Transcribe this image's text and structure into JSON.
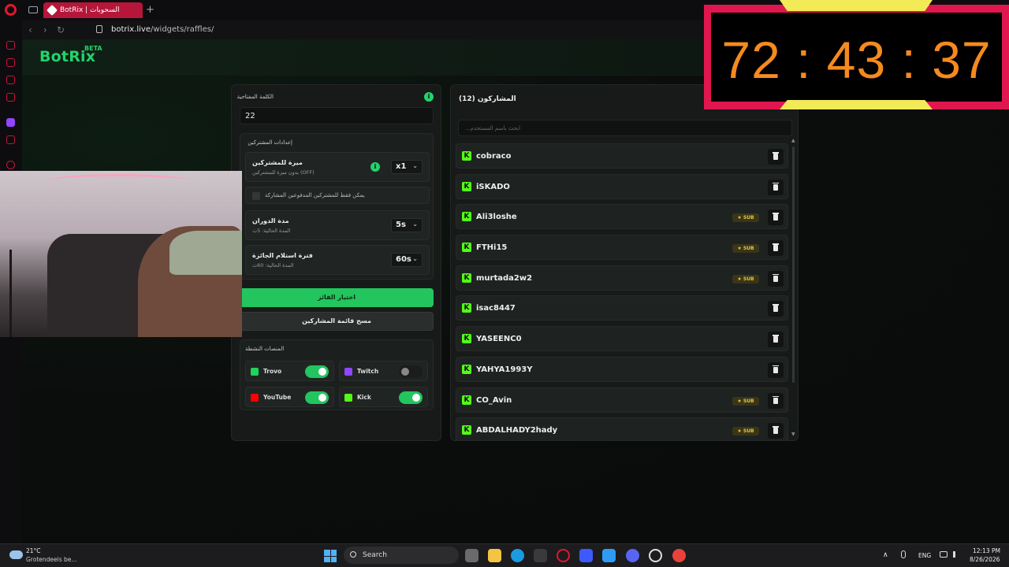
{
  "browser": {
    "tab_title": "BotRix | السحوبات",
    "new_tab": "+",
    "url_host": "botrix.live",
    "url_path": "/widgets/raffles/"
  },
  "header": {
    "logo": "BotRix",
    "beta": "BETA"
  },
  "settings": {
    "keyword_label": "الكلمة المفتاحية",
    "keyword_value": "22",
    "info_icon": "i",
    "subscriber_settings_title": "إعدادات المشتركين",
    "sub_bonus_title": "ميزة للمشتركين",
    "sub_bonus_sub": "بدون ميزة للمشتركين (OFF)",
    "sub_bonus_value": "x1",
    "paid_only_label": "يمكن فقط للمشتركين المدفوعين المشاركة",
    "spin_duration_title": "مدة الدوران",
    "spin_duration_sub": "المدة الحالية: 5ث",
    "spin_duration_value": "5s",
    "claim_period_title": "فترة استلام الجائزة",
    "claim_period_sub": "المدة الحالية: 60ث",
    "claim_period_value": "60s",
    "pick_winner_button": "اختيار الفائز",
    "clear_list_button": "مسح قائمة المشاركين",
    "platforms_title": "المنصات النشطة",
    "platforms": [
      {
        "name": "Trovo",
        "enabled": true,
        "color": "#1fd35c"
      },
      {
        "name": "Twitch",
        "enabled": false,
        "color": "#9146ff"
      },
      {
        "name": "YouTube",
        "enabled": true,
        "color": "#ff0000"
      },
      {
        "name": "Kick",
        "enabled": true,
        "color": "#53fc18"
      }
    ]
  },
  "participants": {
    "title": "المشاركون (12)",
    "search_placeholder": "...ابحث باسم المستخدم",
    "sub_badge": "★ SUB",
    "list": [
      {
        "name": "cobraco",
        "sub": false
      },
      {
        "name": "iSKADO",
        "sub": false
      },
      {
        "name": "Ali3loshe",
        "sub": true
      },
      {
        "name": "FTHi15",
        "sub": true
      },
      {
        "name": "murtada2w2",
        "sub": true
      },
      {
        "name": "isac8447",
        "sub": false
      },
      {
        "name": "YASEENC0",
        "sub": false
      },
      {
        "name": "YAHYA1993Y",
        "sub": false
      },
      {
        "name": "CO_Avin",
        "sub": true
      },
      {
        "name": "ABDALHADY2hady",
        "sub": true
      }
    ]
  },
  "timer": {
    "display": "72 : 43 : 37"
  },
  "taskbar": {
    "temperature": "21°C",
    "weather": "Grotendeels be...",
    "search": "Search",
    "language": "ENG",
    "time": "12:13 PM",
    "date": "8/26/2026"
  },
  "colors": {
    "accent": "#22c55e",
    "brand": "#22d36b",
    "kick": "#53fc18",
    "timer_frame": "#e0164f",
    "timer_digits": "#f58a1f"
  }
}
